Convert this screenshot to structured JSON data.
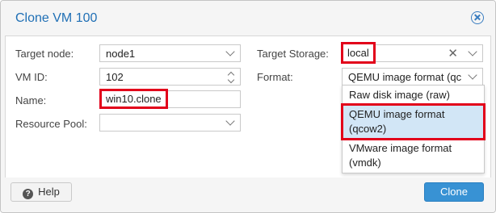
{
  "dialog": {
    "title": "Clone VM 100",
    "close_icon": "close-circle-icon"
  },
  "form": {
    "target_node": {
      "label": "Target node:",
      "value": "node1"
    },
    "vm_id": {
      "label": "VM ID:",
      "value": "102"
    },
    "name": {
      "label": "Name:",
      "value": "win10.clone"
    },
    "resource_pool": {
      "label": "Resource Pool:",
      "value": ""
    },
    "target_storage": {
      "label": "Target Storage:",
      "value": "local"
    },
    "format": {
      "label": "Format:",
      "value": "QEMU image format (qc",
      "options": [
        {
          "text": "Raw disk image (raw)"
        },
        {
          "line1": "QEMU image format",
          "line2": "(qcow2)",
          "selected": true
        },
        {
          "line1": "VMware image format",
          "line2": "(vmdk)"
        }
      ]
    }
  },
  "footer": {
    "help_label": "Help",
    "help_icon": "question-circle-icon",
    "clone_label": "Clone"
  },
  "colors": {
    "title": "#1f6fb5",
    "highlight": "#e2001a",
    "selected_option": "#d2e6f6",
    "primary_button": "#3892d4"
  }
}
